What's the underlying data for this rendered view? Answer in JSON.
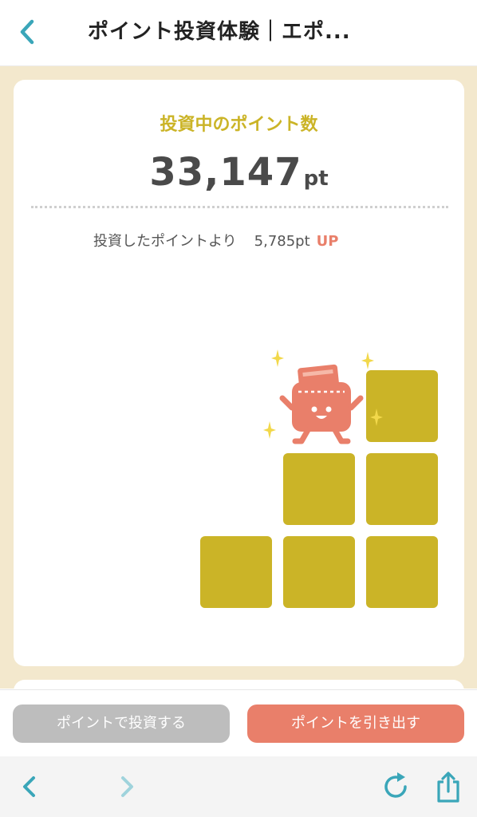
{
  "header": {
    "title": "ポイント投資体験｜エポ...",
    "back_icon": "chevron-left-icon"
  },
  "card": {
    "label": "投資中のポイント数",
    "points_value": "33,147",
    "points_unit": "pt",
    "gain_text": "投資したポイントより",
    "gain_value": "5,785pt",
    "gain_status": "UP"
  },
  "actions": {
    "invest_label": "ポイントで投資する",
    "withdraw_label": "ポイントを引き出す"
  },
  "toolbar": {
    "back_icon": "back-arrow-icon",
    "forward_icon": "forward-arrow-icon",
    "reload_icon": "reload-icon",
    "share_icon": "share-icon"
  },
  "colors": {
    "accent_gold": "#cbb427",
    "accent_coral": "#e97f6a",
    "teal": "#3aa6b9",
    "background_cream": "#f3e8cd"
  }
}
